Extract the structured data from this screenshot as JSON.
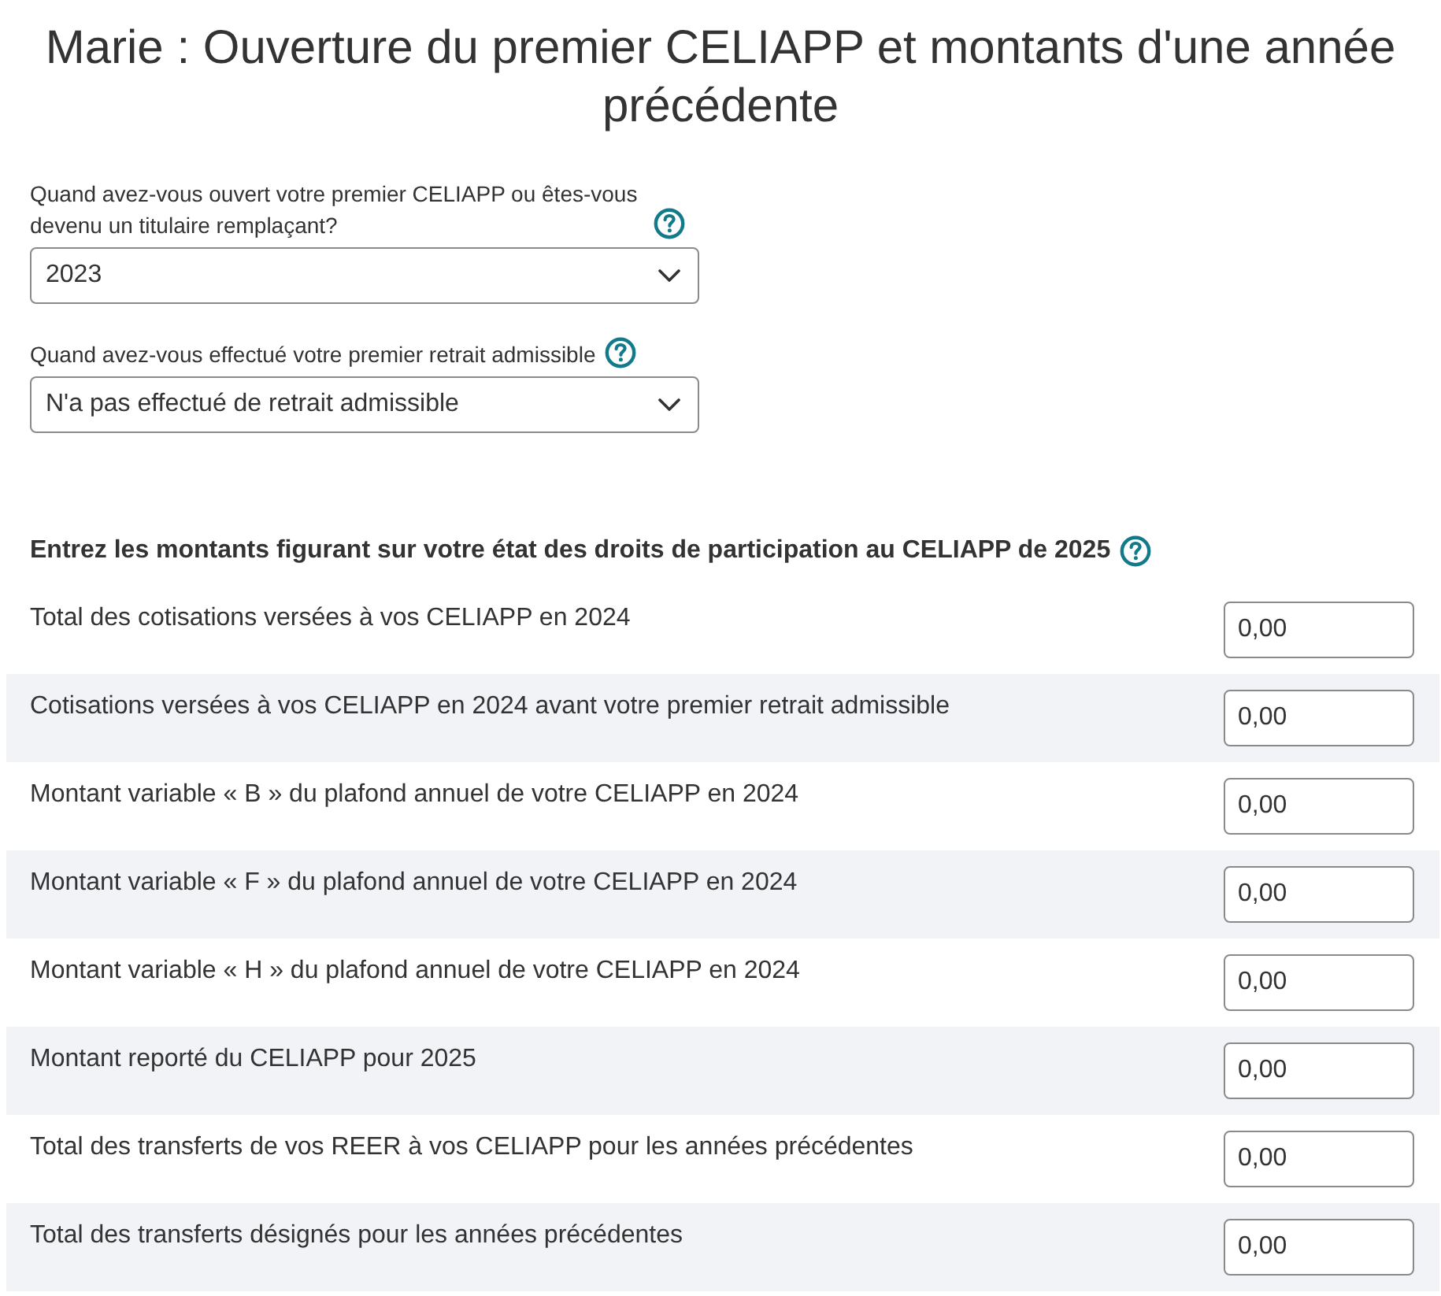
{
  "title": "Marie : Ouverture du premier CELIAPP et montants d'une année précédente",
  "questions": [
    {
      "label": "Quand avez-vous ouvert votre premier CELIAPP ou êtes-vous devenu un titulaire remplaçant?",
      "value": "2023"
    },
    {
      "label": "Quand avez-vous effectué votre premier retrait admissible",
      "value": "N'a pas effectué de retrait admissible"
    }
  ],
  "amounts": {
    "heading": "Entrez les montants figurant sur votre état des droits de participation au CELIAPP de 2025",
    "rows": [
      {
        "label": "Total des cotisations versées à vos CELIAPP en 2024",
        "value": "0,00"
      },
      {
        "label": "Cotisations versées à vos CELIAPP en 2024 avant votre premier retrait admissible",
        "value": "0,00"
      },
      {
        "label": "Montant variable « B » du plafond annuel de votre CELIAPP en 2024",
        "value": "0,00"
      },
      {
        "label": "Montant variable « F » du plafond annuel de votre CELIAPP en 2024",
        "value": "0,00"
      },
      {
        "label": "Montant variable « H » du plafond annuel de votre CELIAPP en 2024",
        "value": "0,00"
      },
      {
        "label": "Montant reporté du CELIAPP pour 2025",
        "value": "0,00"
      },
      {
        "label": "Total des transferts de vos REER à vos CELIAPP pour les années précédentes",
        "value": "0,00"
      },
      {
        "label": "Total des transferts désignés pour les années précédentes",
        "value": "0,00"
      }
    ]
  }
}
